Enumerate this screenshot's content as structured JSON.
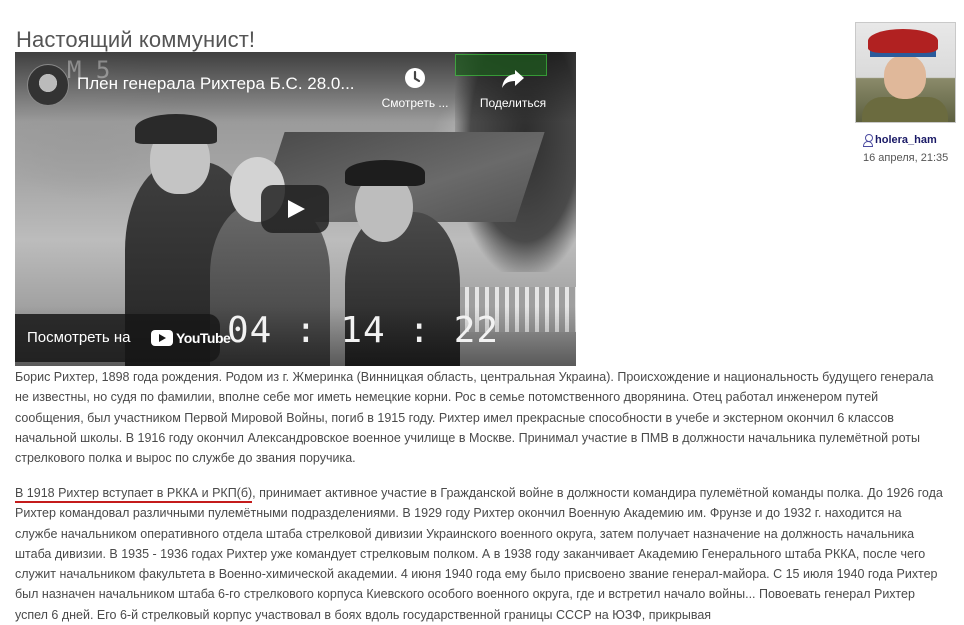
{
  "post": {
    "title": "Настоящий коммунист!"
  },
  "video": {
    "title": "Плен генерала Рихтера Б.С. 28.0...",
    "watch_later_label": "Смотреть ...",
    "share_label": "Поделиться",
    "watch_on_label": "Посмотреть на",
    "youtube_label": "YouTube",
    "timecode": "04 : 14 : 22",
    "overlay_number": "M 5",
    "icons": [
      "watch-later-icon",
      "share-icon",
      "play-icon",
      "youtube-logo-icon"
    ]
  },
  "author": {
    "name": "holera_ham",
    "date": "16 апреля, 21:35"
  },
  "body": {
    "p1": "Борис Рихтер, 1898 года рождения. Родом из г. Жмеринка (Винницкая область, центральная Украина). Происхождение и национальность будущего генерала не известны, но судя по фамилии, вполне себе мог иметь немецкие корни. Рос в семье потомственного дворянина. Отец работал инженером путей сообщения, был участником Первой Мировой Войны, погиб в 1915 году. Рихтер имел прекрасные способности в учебе и экстерном окончил 6 классов начальной школы. В 1916 году окончил Александровское военное училище в Москве. Принимал участие в ПМВ в должности начальника пулемётной роты стрелкового полка и вырос по службе до звания поручика.",
    "p2_highlight": "В 1918 Рихтер вступает в РККА и РКП(б)",
    "p2_rest": ", принимает активное участие в Гражданской войне в должности командира пулемётной команды полка. До 1926 года Рихтер командовал различными пулемётными подразделениями. В 1929 году Рихтер окончил Военную Академию им. Фрунзе и до 1932 г. находится на службе начальником оперативного отдела штаба стрелковой дивизии Украинского военного округа, затем получает назначение на должность начальника штаба дивизии. В 1935 - 1936 годах Рихтер уже командует стрелковым полком. А в 1938 году заканчивает Академию Генерального штаба РККА, после чего служит начальником факультета в Военно-химической академии. 4 июня 1940 года ему было присвоено звание генерал-майора. С 15 июля 1940 года Рихтер был назначен начальником штаба 6-го стрелкового корпуса Киевского особого военного округа, где и встретил начало войны... Повоевать генерал Рихтер успел 6 дней. Его 6-й стрелковый корпус участвовал в боях вдоль государственной границы СССР на ЮЗФ, прикрывая"
  },
  "colors": {
    "title": "#555555",
    "text": "#4a4a4a",
    "author_link": "#1a1a66",
    "underline": "#c41b1b"
  }
}
